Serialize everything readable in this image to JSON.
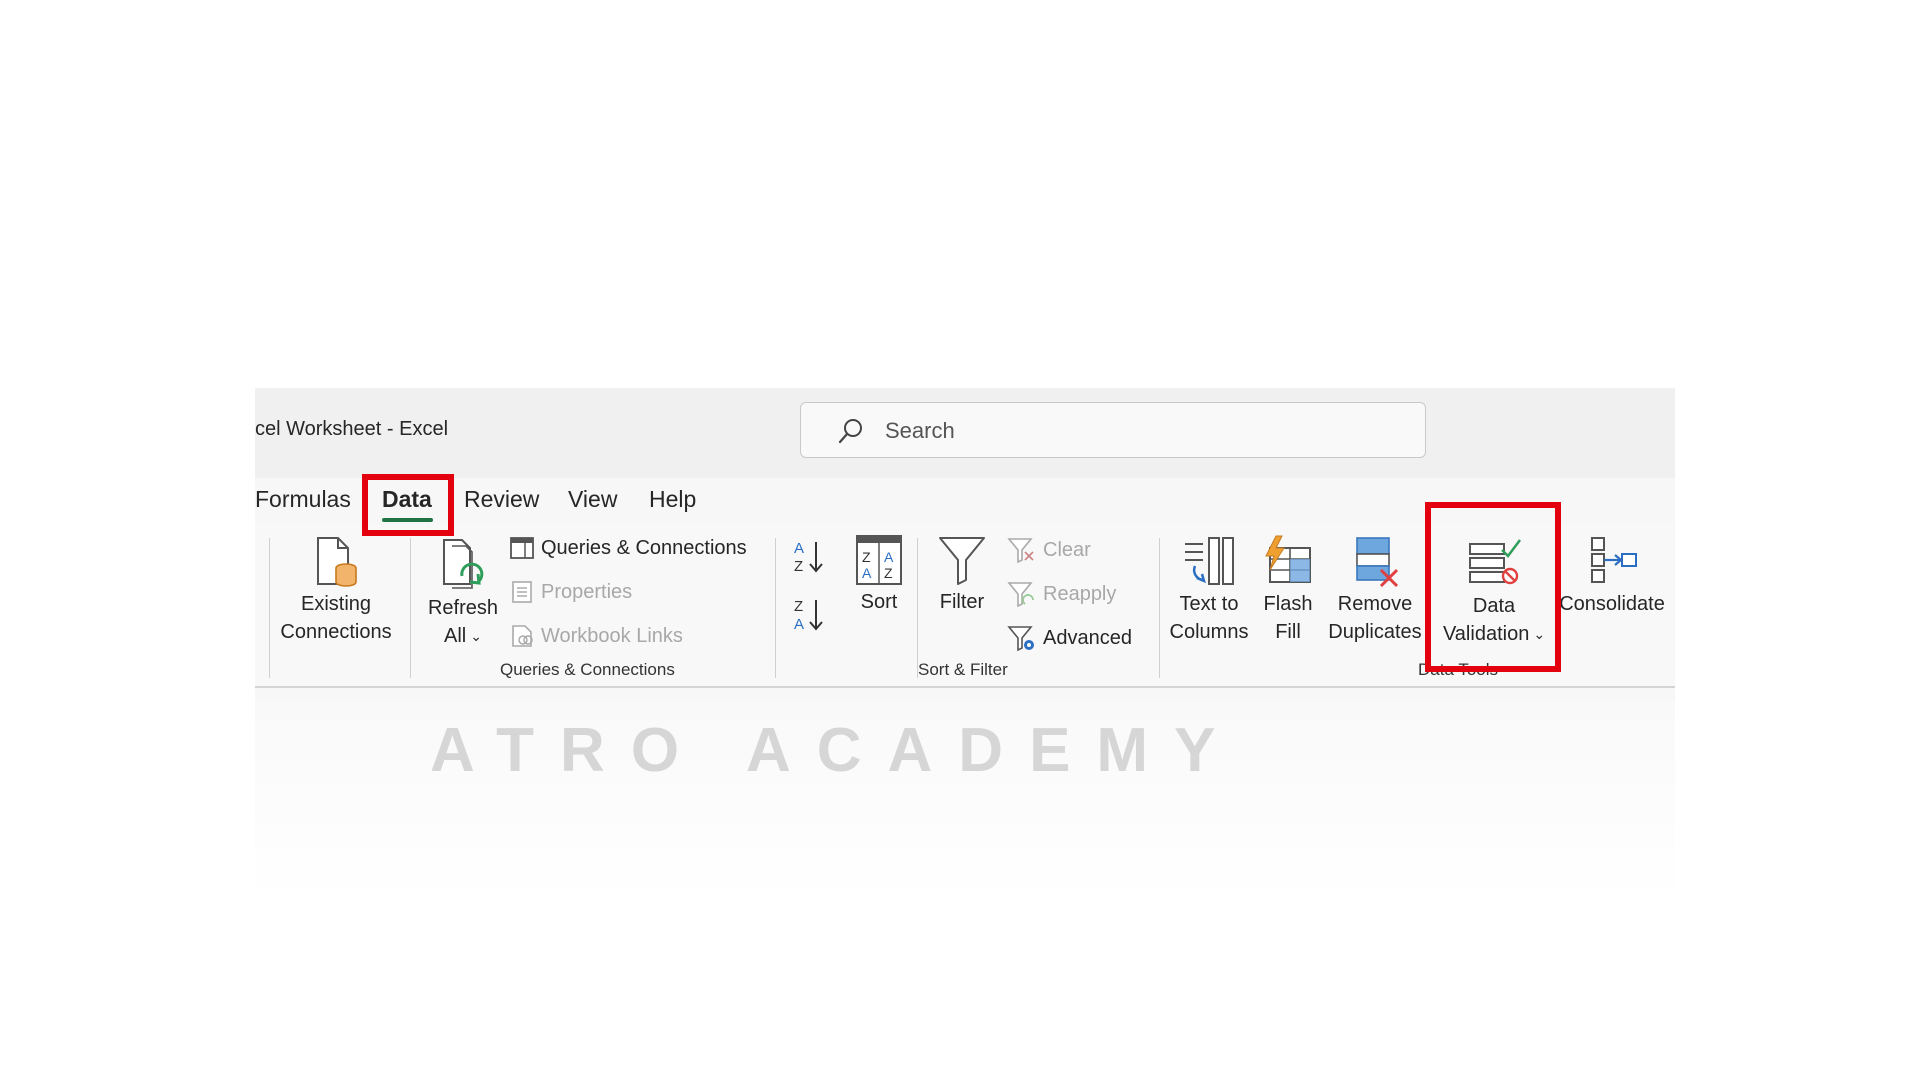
{
  "window": {
    "title": "cel Worksheet  -  Excel"
  },
  "search": {
    "placeholder": "Search"
  },
  "tabs": [
    {
      "label": "Formulas"
    },
    {
      "label": "Data"
    },
    {
      "label": "Review"
    },
    {
      "label": "View"
    },
    {
      "label": "Help"
    }
  ],
  "ribbon": {
    "existing_connections": {
      "line1": "Existing",
      "line2": "Connections"
    },
    "refresh_all": {
      "line1": "Refresh",
      "line2": "All"
    },
    "queries_connections": {
      "label": "Queries & Connections"
    },
    "properties": {
      "label": "Properties"
    },
    "workbook_links": {
      "label": "Workbook Links"
    },
    "sort": {
      "label": "Sort"
    },
    "filter": {
      "label": "Filter"
    },
    "clear": {
      "label": "Clear"
    },
    "reapply": {
      "label": "Reapply"
    },
    "advanced": {
      "label": "Advanced"
    },
    "text_to_columns": {
      "line1": "Text to",
      "line2": "Columns"
    },
    "flash_fill": {
      "line1": "Flash",
      "line2": "Fill"
    },
    "remove_duplicates": {
      "line1": "Remove",
      "line2": "Duplicates"
    },
    "data_validation": {
      "line1": "Data",
      "line2": "Validation"
    },
    "consolidate": {
      "label": "Consolidate"
    },
    "groups": {
      "queries_connections": "Queries & Connections",
      "sort_filter": "Sort & Filter",
      "data_tools": "Data Tools"
    }
  },
  "watermark": {
    "text": "ATRO ACADEMY"
  },
  "colors": {
    "accent": "#217346",
    "highlight": "#e3000f"
  }
}
